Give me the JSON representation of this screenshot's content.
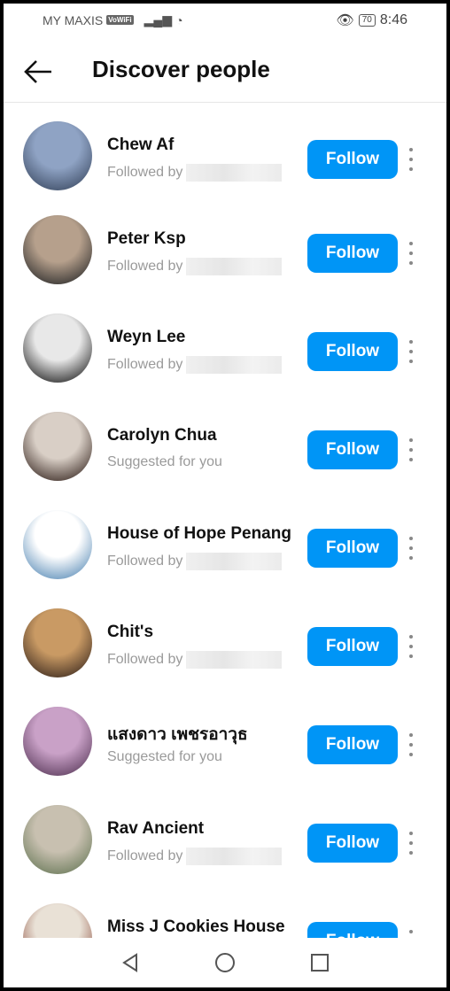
{
  "status": {
    "carrier": "MY MAXIS",
    "vowifi": "VoWiFi",
    "battery": "70",
    "time": "8:46"
  },
  "header": {
    "title": "Discover people"
  },
  "follow_label": "Follow",
  "people": [
    {
      "name": "Chew Af",
      "subtitle": "Followed by",
      "redacted": true,
      "avatar": [
        "#8fa3c4",
        "#3b4a63"
      ]
    },
    {
      "name": "Peter Ksp",
      "subtitle": "Followed by",
      "redacted": true,
      "avatar": [
        "#b6a08c",
        "#2b2b2b"
      ]
    },
    {
      "name": "Weyn Lee",
      "subtitle": "Followed by",
      "redacted": true,
      "avatar": [
        "#e8e8e8",
        "#222"
      ]
    },
    {
      "name": "Carolyn Chua",
      "subtitle": "Suggested for you",
      "redacted": false,
      "avatar": [
        "#d9cfc6",
        "#3a2a24"
      ]
    },
    {
      "name": "House of Hope Penang",
      "subtitle": "Followed by",
      "redacted": true,
      "avatar": [
        "#ffffff",
        "#5b8db8"
      ]
    },
    {
      "name": "Chit's",
      "subtitle": "Followed by",
      "redacted": true,
      "avatar": [
        "#c99a64",
        "#3c2a1f"
      ]
    },
    {
      "name": "แสงดาว เพชรอาวุธ",
      "subtitle": "Suggested for you",
      "redacted": false,
      "avatar": [
        "#c9a1c7",
        "#5b3b5c"
      ]
    },
    {
      "name": "Rav Ancient",
      "subtitle": "Followed by",
      "redacted": true,
      "avatar": [
        "#c8c0b0",
        "#6a7a5a"
      ]
    },
    {
      "name": "Miss J Cookies House",
      "subtitle": "",
      "redacted": false,
      "avatar": [
        "#e9e1d6",
        "#8a4a3a"
      ]
    }
  ]
}
